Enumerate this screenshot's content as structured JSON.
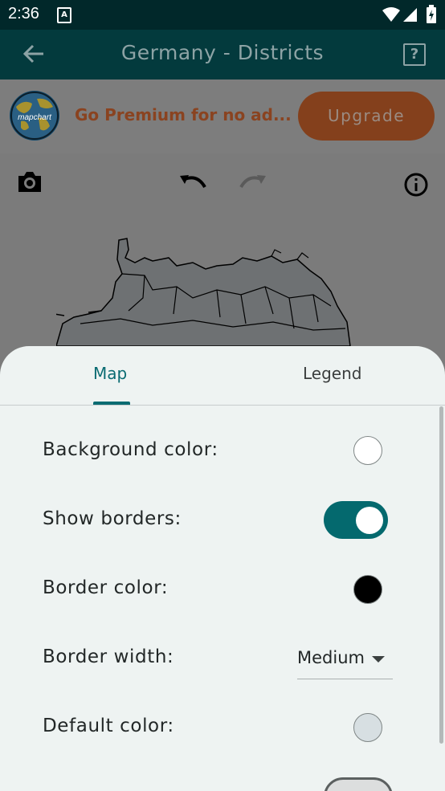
{
  "status_bar": {
    "time": "2:36",
    "notification_badge": "A"
  },
  "toolbar": {
    "back_icon": "arrow-left-icon",
    "title": "Germany - Districts",
    "help_label": "?"
  },
  "banner": {
    "logo_text": "mapchart",
    "promo_text": "Go Premium for no ad...",
    "upgrade_label": "Upgrade"
  },
  "map_toolbar": {
    "icons": [
      "camera-icon",
      "undo-icon",
      "redo-icon",
      "info-icon"
    ]
  },
  "sheet": {
    "tabs": [
      {
        "label": "Map",
        "active": true
      },
      {
        "label": "Legend",
        "active": false
      }
    ],
    "settings": {
      "background_color_label": "Background color:",
      "background_color": "#ffffff",
      "show_borders_label": "Show borders:",
      "show_borders": true,
      "border_color_label": "Border color:",
      "border_color": "#000000",
      "border_width_label": "Border width:",
      "border_width_value": "Medium",
      "default_color_label": "Default color:",
      "default_color": "#d7dfe2"
    }
  },
  "colors": {
    "accent": "#0a6b72",
    "toolbar_bg": "#033a3d",
    "status_bg": "#01282a",
    "upgrade_bg": "#84401c"
  }
}
